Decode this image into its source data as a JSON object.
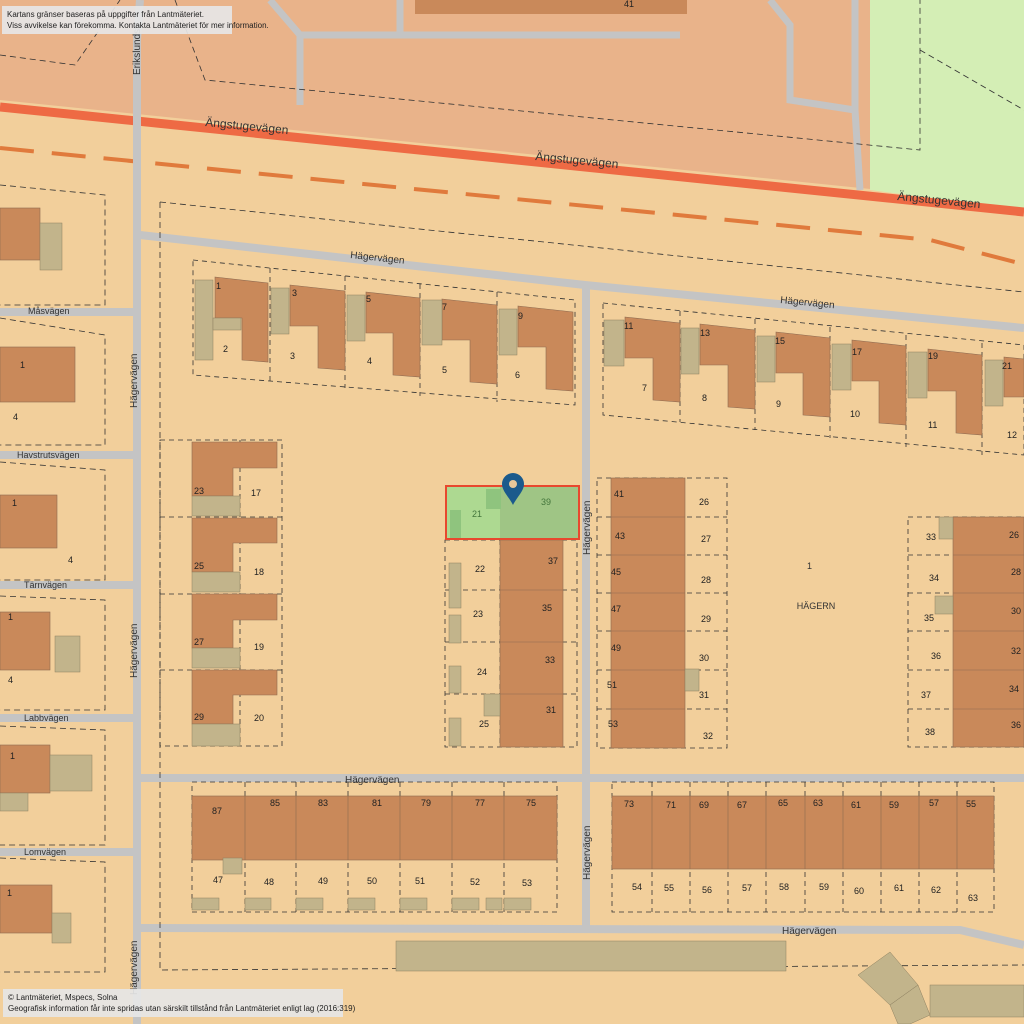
{
  "notices": {
    "top": [
      "Kartans gränser baseras på uppgifter från Lantmäteriet.",
      "Viss avvikelse kan förekomma. Kontakta Lantmäteriet för mer information."
    ],
    "bottom": [
      "© Lantmäteriet, Mspecs, Solna",
      "Geografisk information får inte spridas utan särskilt tillstånd från Lantmäteriet enligt lag (2016:319)"
    ]
  },
  "roads": {
    "main": "Ängstugevägen",
    "hager": "Hägervägen",
    "eriks": "Erikslundsv",
    "masv": "Måsvägen",
    "havs": "Havstrutsvägen",
    "tarn": "Tärnvägen",
    "labb": "Labbvägen",
    "lomv": "Lomvägen"
  },
  "area": {
    "name": "HÄGERN",
    "number": "1"
  },
  "selected": {
    "label_a": "21",
    "label_b": "39"
  },
  "plots": {
    "row1": [
      "1",
      "2",
      "3",
      "3",
      "5",
      "4",
      "7",
      "5",
      "9",
      "6"
    ],
    "row2": [
      "11",
      "7",
      "13",
      "8",
      "15",
      "9",
      "17",
      "10",
      "19",
      "11",
      "21",
      "12"
    ],
    "left_col": [
      "23",
      "17",
      "25",
      "18",
      "27",
      "19",
      "29",
      "20"
    ],
    "mid_left": [
      "22",
      "37",
      "23",
      "35",
      "24",
      "33",
      "25",
      "31"
    ],
    "mid_right": [
      "41",
      "26",
      "43",
      "27",
      "45",
      "28",
      "47",
      "29",
      "49",
      "30",
      "51",
      "31",
      "53",
      "32"
    ],
    "right_col": [
      "33",
      "26",
      "34",
      "28",
      "35",
      "30",
      "36",
      "32",
      "37",
      "34",
      "38",
      "36"
    ],
    "bottom_left_top": [
      "87",
      "85",
      "83",
      "81",
      "79",
      "77",
      "75"
    ],
    "bottom_left_bot": [
      "47",
      "48",
      "49",
      "50",
      "51",
      "52",
      "53"
    ],
    "bottom_right_top": [
      "73",
      "71",
      "69",
      "67",
      "65",
      "63",
      "61",
      "59",
      "57",
      "55"
    ],
    "bottom_right_bot": [
      "54",
      "55",
      "56",
      "57",
      "58",
      "59",
      "60",
      "61",
      "62",
      "63"
    ],
    "west": [
      "1",
      "4",
      "1",
      "4",
      "1",
      "4",
      "1",
      "1"
    ],
    "north": "41"
  },
  "colors": {
    "land": "#f2cf9b",
    "land_north": "#e9b38a",
    "park": "#d4eeb5",
    "house": "#c9895a",
    "outbuilding": "#c2b48b",
    "road": "#c4c4c4",
    "main_road": "#ee6a44",
    "selected_fill": "#a5d990",
    "selected_border": "#e8482e",
    "pin": "#1b5a8c"
  },
  "icons": {
    "pin": "map-pin-icon"
  }
}
